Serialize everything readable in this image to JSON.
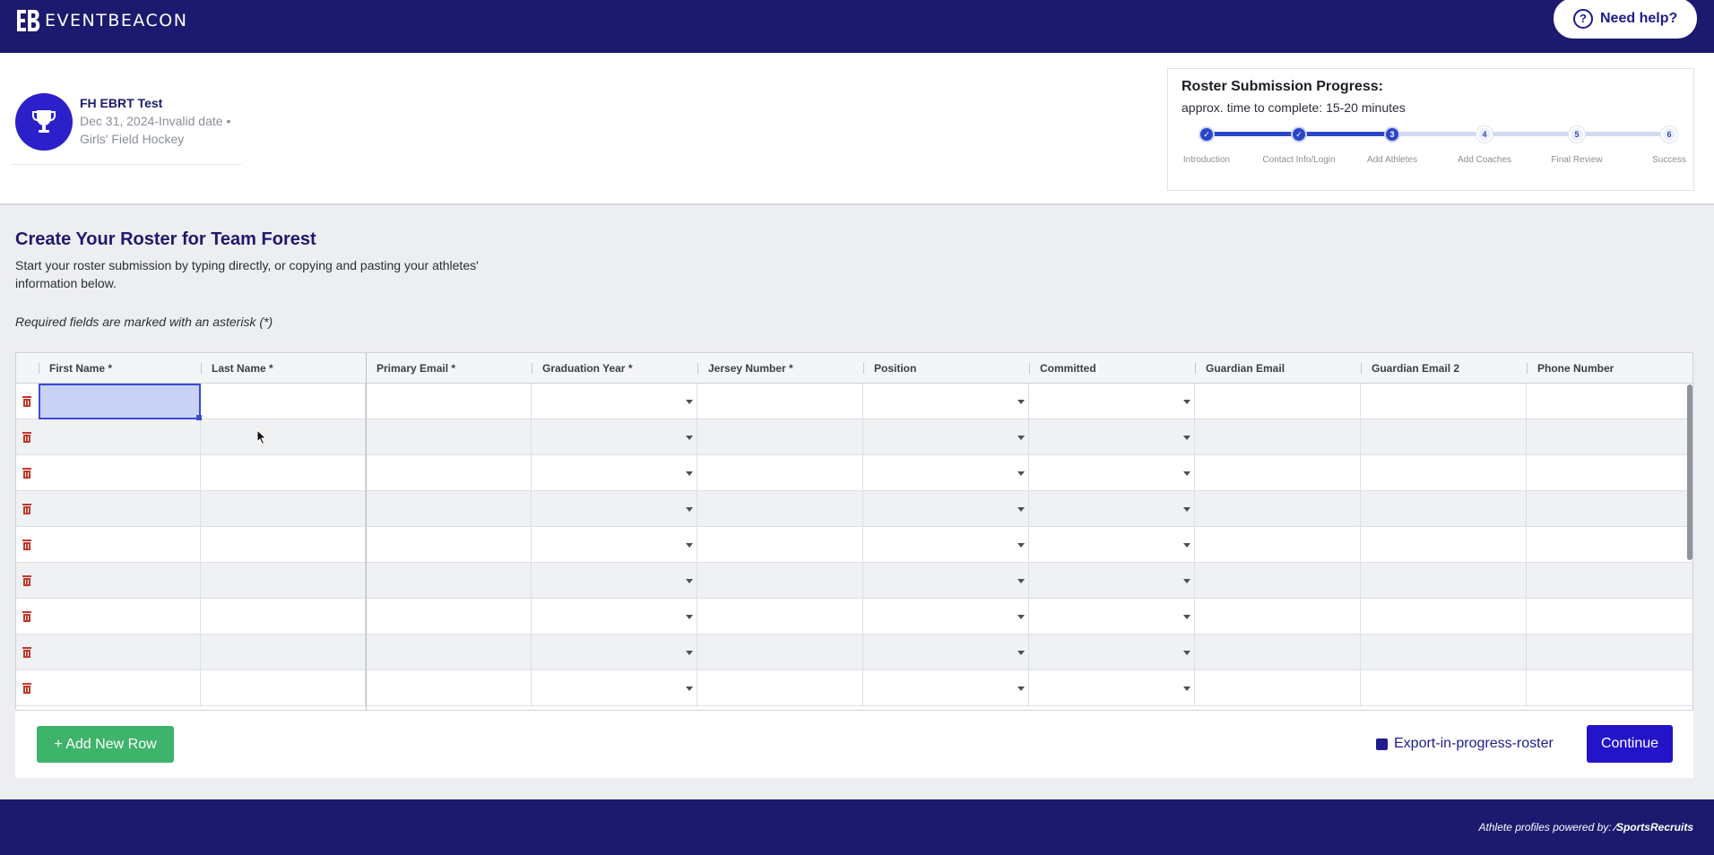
{
  "brand": {
    "name": "EVENTBEACON"
  },
  "help": {
    "label": "Need help?"
  },
  "event": {
    "name": "FH EBRT Test",
    "date": "Dec 31, 2024-Invalid date •",
    "sport": "Girls' Field Hockey"
  },
  "progress": {
    "title": "Roster Submission Progress:",
    "subtitle": "approx. time to complete: 15-20 minutes",
    "steps": [
      {
        "num": "✓",
        "label": "Introduction",
        "done": true
      },
      {
        "num": "✓",
        "label": "Contact Info/Login",
        "done": true
      },
      {
        "num": "3",
        "label": "Add Athletes",
        "done": true
      },
      {
        "num": "4",
        "label": "Add Coaches",
        "done": false
      },
      {
        "num": "5",
        "label": "Final Review",
        "done": false
      },
      {
        "num": "6",
        "label": "Success",
        "done": false
      }
    ],
    "current_step": 3
  },
  "main": {
    "title": "Create Your Roster for Team Forest",
    "description": "Start your roster submission by typing directly, or copying and pasting your athletes' information below.",
    "required_note": "Required fields are marked with an asterisk (*)"
  },
  "grid": {
    "columns": [
      "First Name *",
      "Last Name *",
      "Primary Email *",
      "Graduation Year *",
      "Jersey Number *",
      "Position",
      "Committed",
      "Guardian Email",
      "Guardian Email 2",
      "Phone Number"
    ],
    "dropdown_columns": [
      "Graduation Year *",
      "Position",
      "Committed"
    ],
    "row_count": 9
  },
  "actions": {
    "add_row": "+ Add New Row",
    "export": "Export-in-progress-roster",
    "continue": "Continue"
  },
  "footer": {
    "powered_by": "Athlete profiles powered by:",
    "partner": "SportsRecruits"
  },
  "colors": {
    "navy": "#1c1a6e",
    "accent": "#2a46c8",
    "green": "#3eb36a",
    "delete_red": "#c0392b"
  }
}
